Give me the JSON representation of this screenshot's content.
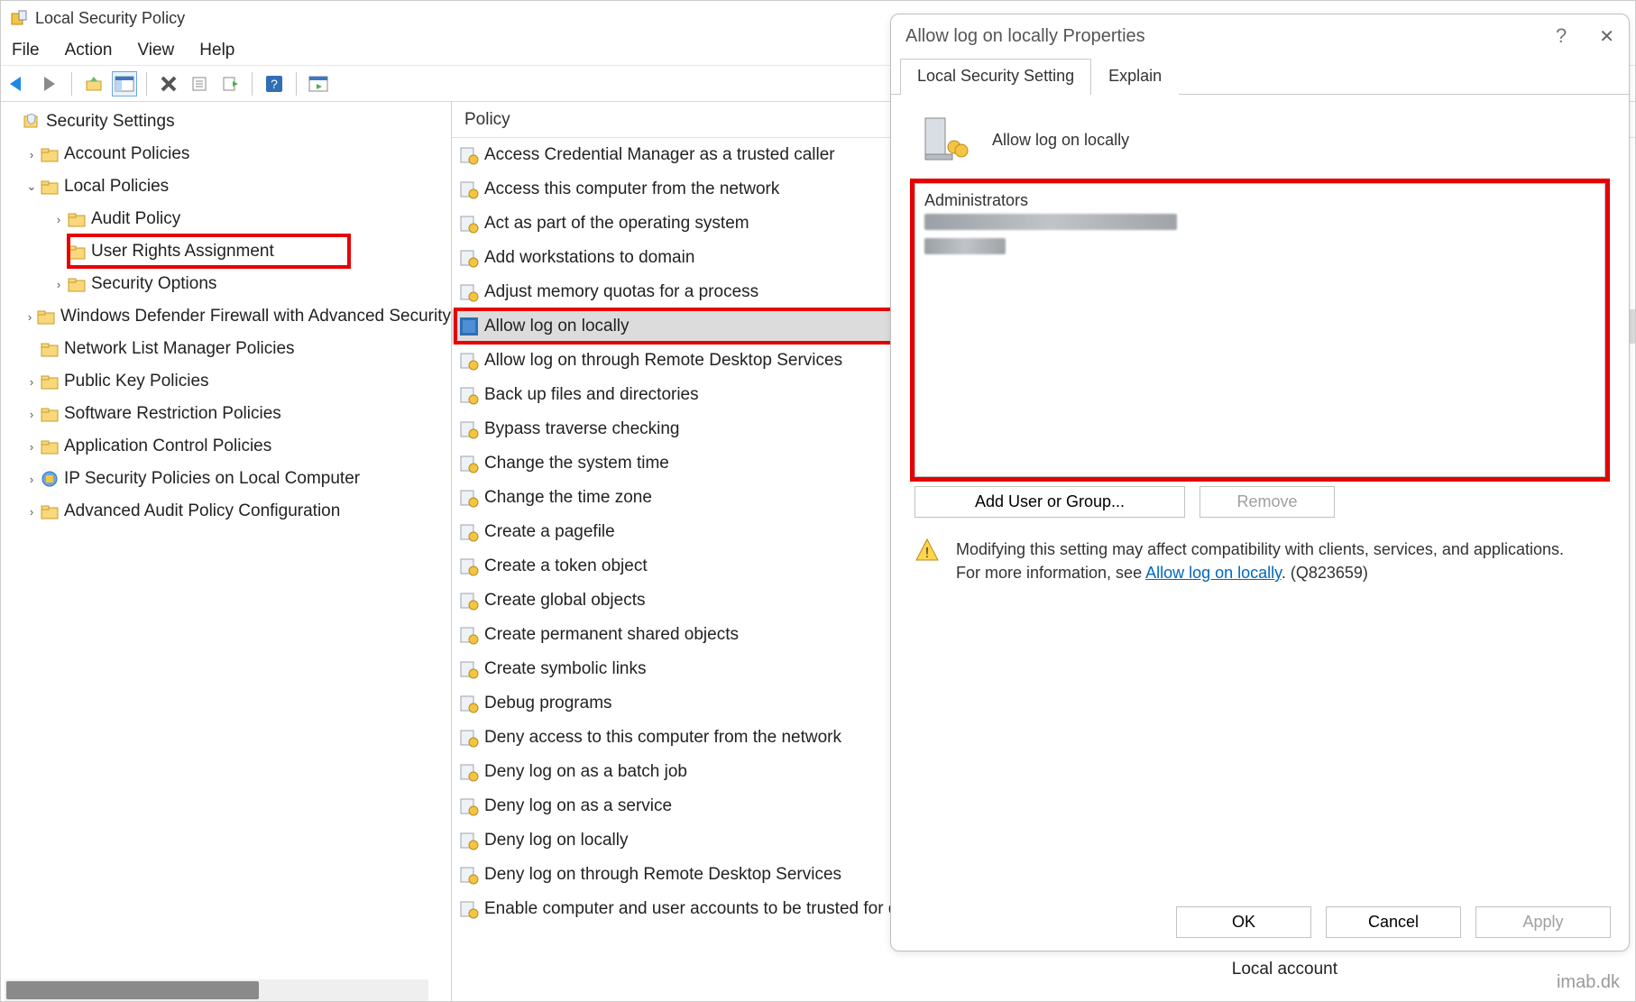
{
  "window": {
    "title": "Local Security Policy"
  },
  "menu": [
    "File",
    "Action",
    "View",
    "Help"
  ],
  "tree": {
    "root": "Security Settings",
    "items": [
      {
        "label": "Account Policies",
        "indent": 1,
        "exp": "›"
      },
      {
        "label": "Local Policies",
        "indent": 1,
        "exp": "⌄"
      },
      {
        "label": "Audit Policy",
        "indent": 2,
        "exp": "›"
      },
      {
        "label": "User Rights Assignment",
        "indent": 2,
        "exp": "",
        "highlight": true
      },
      {
        "label": "Security Options",
        "indent": 2,
        "exp": "›"
      },
      {
        "label": "Windows Defender Firewall with Advanced Security",
        "indent": 1,
        "exp": "›"
      },
      {
        "label": "Network List Manager Policies",
        "indent": 1,
        "exp": ""
      },
      {
        "label": "Public Key Policies",
        "indent": 1,
        "exp": "›"
      },
      {
        "label": "Software Restriction Policies",
        "indent": 1,
        "exp": "›"
      },
      {
        "label": "Application Control Policies",
        "indent": 1,
        "exp": "›"
      },
      {
        "label": "IP Security Policies on Local Computer",
        "indent": 1,
        "exp": "›",
        "special": "ipsec"
      },
      {
        "label": "Advanced Audit Policy Configuration",
        "indent": 1,
        "exp": "›"
      }
    ]
  },
  "list": {
    "header": "Policy",
    "items": [
      "Access Credential Manager as a trusted caller",
      "Access this computer from the network",
      "Act as part of the operating system",
      "Add workstations to domain",
      "Adjust memory quotas for a process",
      "Allow log on locally",
      "Allow log on through Remote Desktop Services",
      "Back up files and directories",
      "Bypass traverse checking",
      "Change the system time",
      "Change the time zone",
      "Create a pagefile",
      "Create a token object",
      "Create global objects",
      "Create permanent shared objects",
      "Create symbolic links",
      "Debug programs",
      "Deny access to this computer from the network",
      "Deny log on as a batch job",
      "Deny log on as a service",
      "Deny log on locally",
      "Deny log on through Remote Desktop Services",
      "Enable computer and user accounts to be trusted for delegation"
    ],
    "selected_index": 5,
    "extra_visible_value": "Local account"
  },
  "dialog": {
    "title": "Allow log on locally Properties",
    "tabs": {
      "active": "Local Security Setting",
      "inactive": "Explain"
    },
    "policy_name": "Allow log on locally",
    "users": [
      "Administrators"
    ],
    "buttons": {
      "add": "Add User or Group...",
      "remove": "Remove",
      "ok": "OK",
      "cancel": "Cancel",
      "apply": "Apply"
    },
    "warning_line1": "Modifying this setting may affect compatibility with clients, services, and applications.",
    "warning_line2_prefix": "For more information, see ",
    "warning_link": "Allow log on locally",
    "warning_line2_suffix": ". (Q823659)"
  },
  "watermark": "imab.dk"
}
